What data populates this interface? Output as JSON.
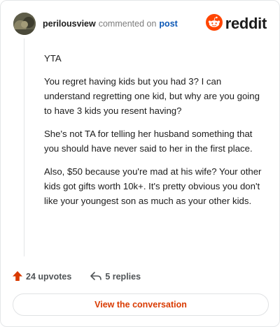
{
  "header": {
    "username": "perilousview",
    "action": "commented on",
    "link_text": "post",
    "brand": "reddit"
  },
  "comment": {
    "paragraphs": [
      "YTA",
      "You regret having kids but you had 3? I can understand regretting one kid, but why are you going to have 3 kids you resent having?",
      "She's not TA for telling her husband something that you should have never said to her in the first place.",
      "Also, $50 because you're mad at his wife? Your other kids got gifts worth 10k+. It's pretty obvious you don't like your youngest son as much as your other kids."
    ]
  },
  "footer": {
    "upvotes": "24 upvotes",
    "replies": "5 replies"
  },
  "cta": {
    "label": "View the conversation"
  },
  "colors": {
    "brand_orange": "#ff4500",
    "cta_text": "#d93a00",
    "link_blue": "#0b57b6"
  },
  "icons": {
    "brand": "reddit-snoo-icon",
    "upvote": "upvote-arrow-icon",
    "reply": "reply-arrow-icon"
  }
}
